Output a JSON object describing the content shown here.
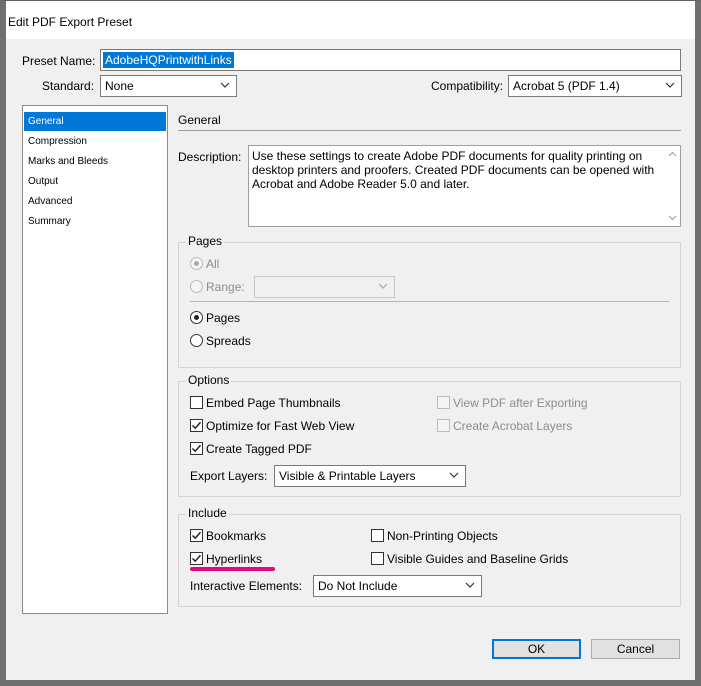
{
  "window": {
    "title": "Edit PDF Export Preset"
  },
  "preset": {
    "name_label": "Preset Name:",
    "name_value": "AdobeHQPrintwithLinks",
    "standard_label": "Standard:",
    "standard_value": "None",
    "compatibility_label": "Compatibility:",
    "compatibility_value": "Acrobat 5 (PDF 1.4)"
  },
  "sidebar": {
    "items": [
      {
        "label": "General",
        "selected": true
      },
      {
        "label": "Compression"
      },
      {
        "label": "Marks and Bleeds"
      },
      {
        "label": "Output"
      },
      {
        "label": "Advanced"
      },
      {
        "label": "Summary"
      }
    ]
  },
  "general": {
    "section_title": "General",
    "description_label": "Description:",
    "description_text": "Use these settings to create Adobe PDF documents for quality printing on desktop printers and proofers.  Created PDF documents can be opened with Acrobat and Adobe Reader 5.0 and later."
  },
  "pages": {
    "group_label": "Pages",
    "all_label": "All",
    "range_label": "Range:",
    "range_value": "",
    "pages_label": "Pages",
    "spreads_label": "Spreads",
    "selected": "Pages"
  },
  "options": {
    "group_label": "Options",
    "embed_thumbnails": {
      "label": "Embed Page Thumbnails",
      "checked": false
    },
    "optimize_web": {
      "label": "Optimize for Fast Web View",
      "checked": true
    },
    "tagged_pdf": {
      "label": "Create Tagged PDF",
      "checked": true
    },
    "view_after": {
      "label": "View PDF after Exporting",
      "checked": false,
      "disabled": true
    },
    "acrobat_layers": {
      "label": "Create Acrobat Layers",
      "checked": false,
      "disabled": true
    },
    "export_layers_label": "Export Layers:",
    "export_layers_value": "Visible & Printable Layers"
  },
  "include": {
    "group_label": "Include",
    "bookmarks": {
      "label": "Bookmarks",
      "checked": true
    },
    "hyperlinks": {
      "label": "Hyperlinks",
      "checked": true
    },
    "non_printing": {
      "label": "Non-Printing Objects",
      "checked": false
    },
    "guides": {
      "label": "Visible Guides and Baseline Grids",
      "checked": false
    },
    "interactive_label": "Interactive Elements:",
    "interactive_value": "Do Not Include"
  },
  "buttons": {
    "ok": "OK",
    "cancel": "Cancel"
  },
  "colors": {
    "accent": "#0078d7",
    "highlight": "#e5097f"
  }
}
